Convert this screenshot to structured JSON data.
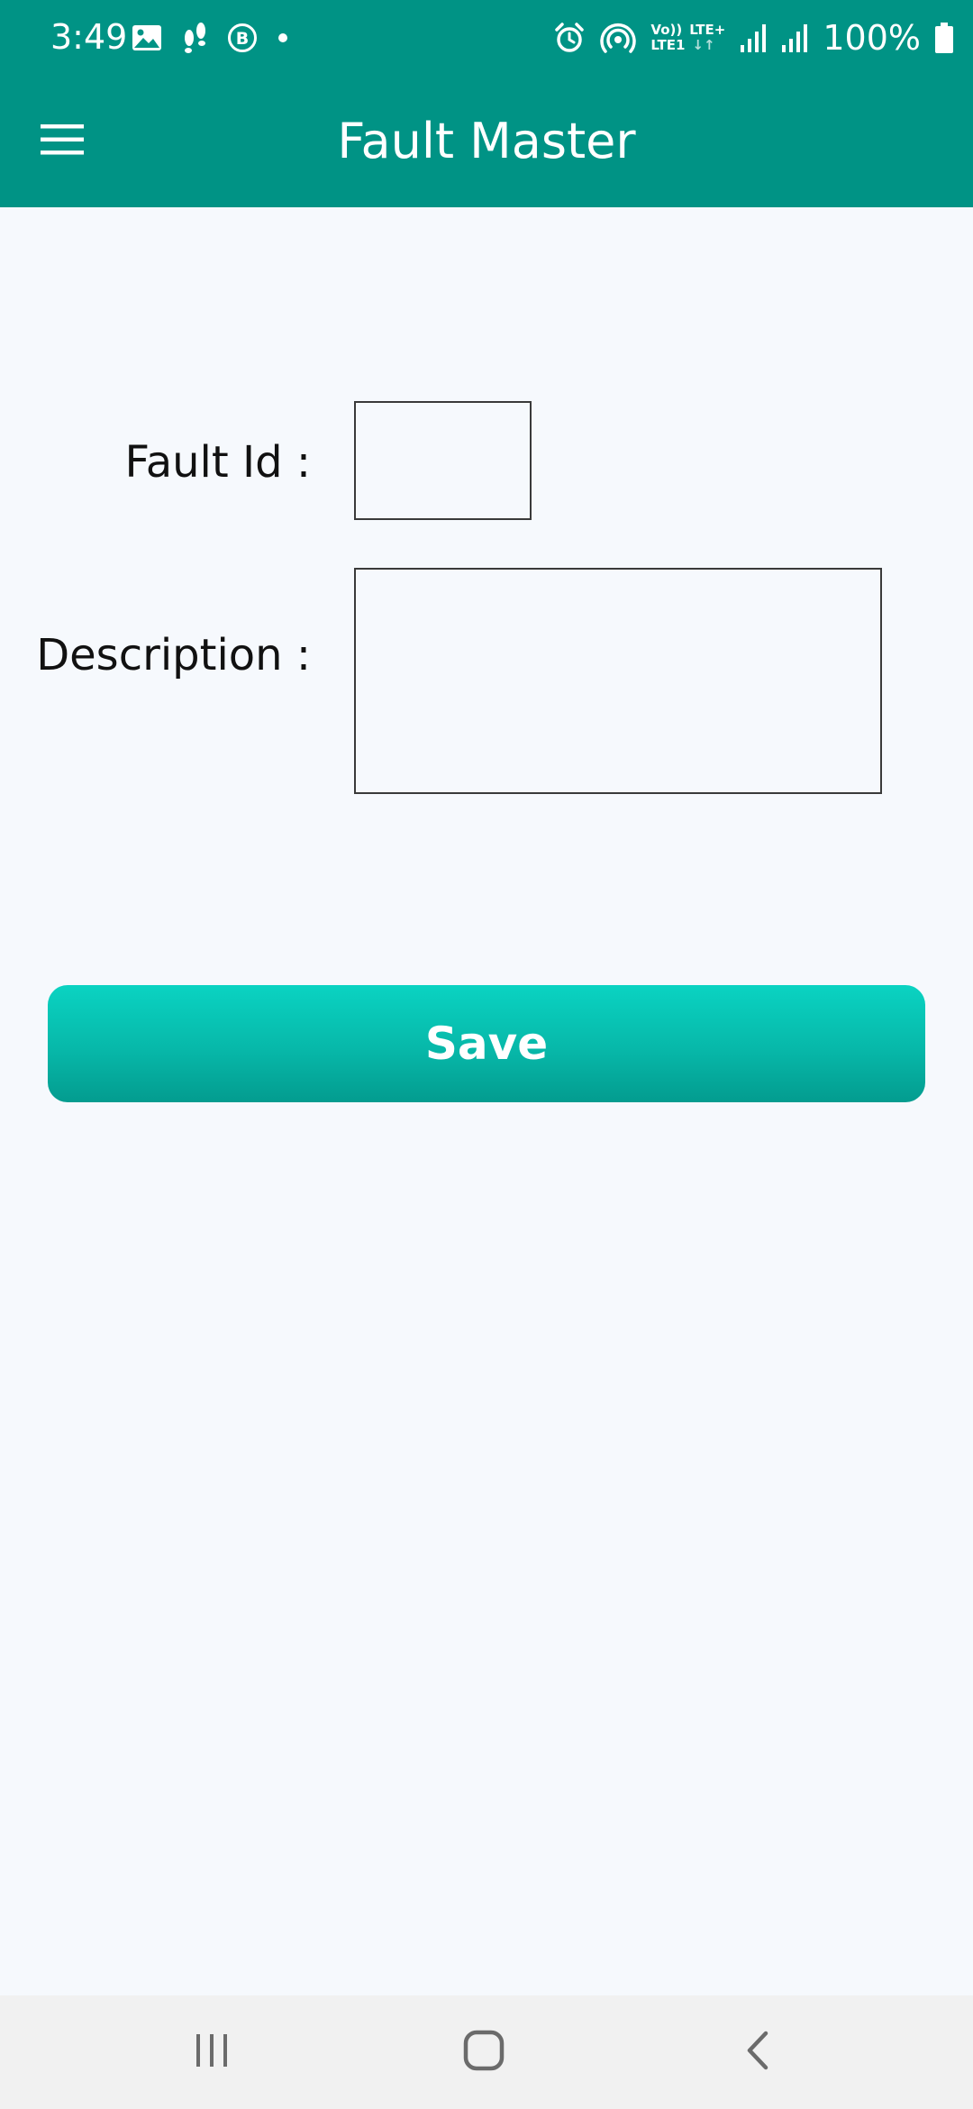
{
  "status_bar": {
    "time": "3:49",
    "network_top": [
      "Vo))",
      "LTE+"
    ],
    "network_bottom": [
      "LTE1",
      "↓↑"
    ],
    "battery": "100%",
    "icons": [
      "gallery-icon",
      "footsteps-icon",
      "b-badge-icon",
      "dot-icon",
      "alarm-icon",
      "hotspot-icon",
      "signal-icon",
      "signal-icon",
      "battery-icon"
    ]
  },
  "app_bar": {
    "title": "Fault Master",
    "menu_icon": "hamburger-menu-icon"
  },
  "form": {
    "fault_id_label": "Fault Id :",
    "fault_id_value": "",
    "description_label": "Description :",
    "description_value": "",
    "save_label": "Save"
  },
  "nav_bar": {
    "icons": [
      "recents-icon",
      "home-icon",
      "back-icon"
    ]
  },
  "colors": {
    "primary": "#009385",
    "button": "#07b8a9",
    "background": "#f6f9fd",
    "nav_bar": "#f1f1f1"
  }
}
